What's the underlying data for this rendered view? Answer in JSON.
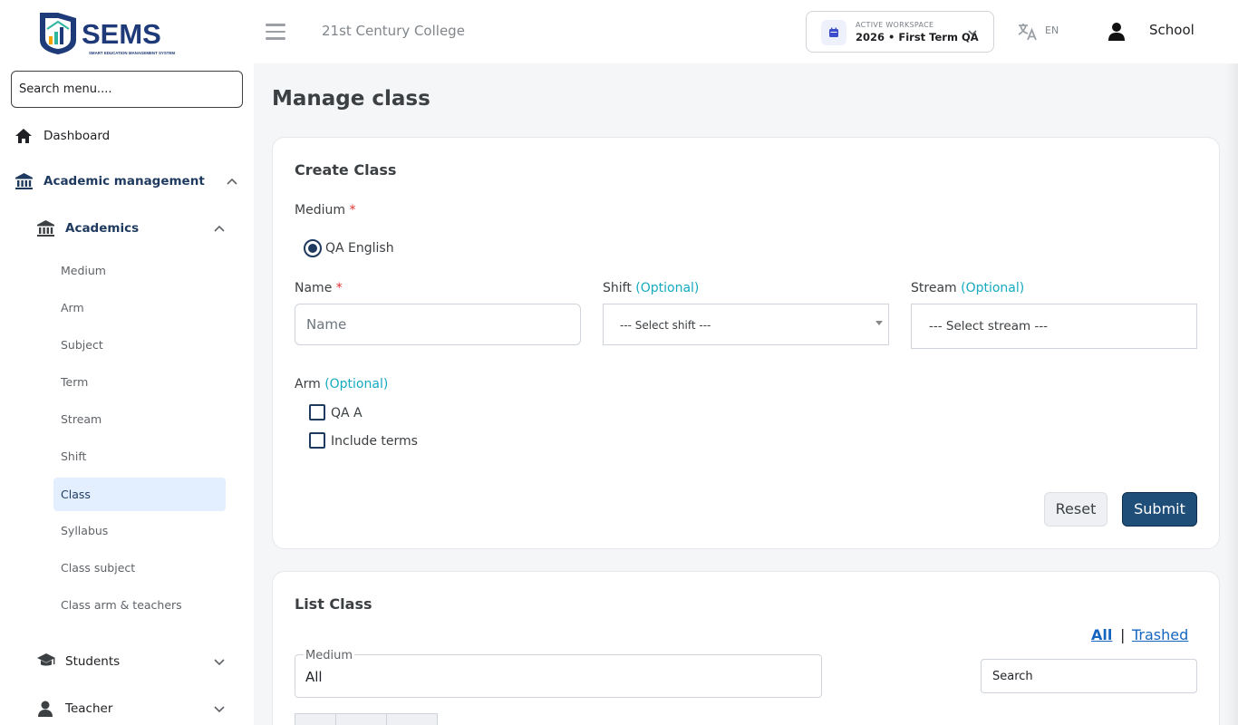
{
  "header": {
    "logo_text": "SEMS",
    "logo_tagline": "SMART EDUCATION MANAGEMENT SYSTEM",
    "college_name": "21st Century College",
    "workspace_label": "ACTIVE WORKSPACE",
    "workspace_value": "2026 • First Term QA",
    "language": "EN",
    "user_name": "School"
  },
  "sidebar": {
    "search_placeholder": "Search menu....",
    "dashboard": "Dashboard",
    "academic_management": "Academic management",
    "academics": "Academics",
    "sub_items": [
      "Medium",
      "Arm",
      "Subject",
      "Term",
      "Stream",
      "Shift",
      "Class",
      "Syllabus",
      "Class subject",
      "Class arm & teachers"
    ],
    "active_sub_item": "Class",
    "students": "Students",
    "teacher": "Teacher"
  },
  "main": {
    "page_title": "Manage class",
    "create_card": {
      "title": "Create Class",
      "medium_label": "Medium",
      "required_mark": "*",
      "medium_option": "QA English",
      "name_label": "Name",
      "name_placeholder": "Name",
      "shift_label": "Shift",
      "optional_text": "(Optional)",
      "shift_placeholder": "--- Select shift ---",
      "stream_label": "Stream",
      "stream_placeholder": "--- Select stream ---",
      "arm_label": "Arm",
      "arm_options": [
        "QA A",
        "Include terms"
      ],
      "reset_label": "Reset",
      "submit_label": "Submit"
    },
    "list_card": {
      "title": "List Class",
      "filter_all": "All",
      "filter_separator": "|",
      "filter_trashed": "Trashed",
      "medium_legend": "Medium",
      "medium_value": "All",
      "search_placeholder": "Search"
    }
  },
  "colors": {
    "primary": "#1f4e79",
    "active_bg": "#e3efff",
    "optional": "#15aabf",
    "required": "#e03131",
    "link": "#1565c0"
  }
}
